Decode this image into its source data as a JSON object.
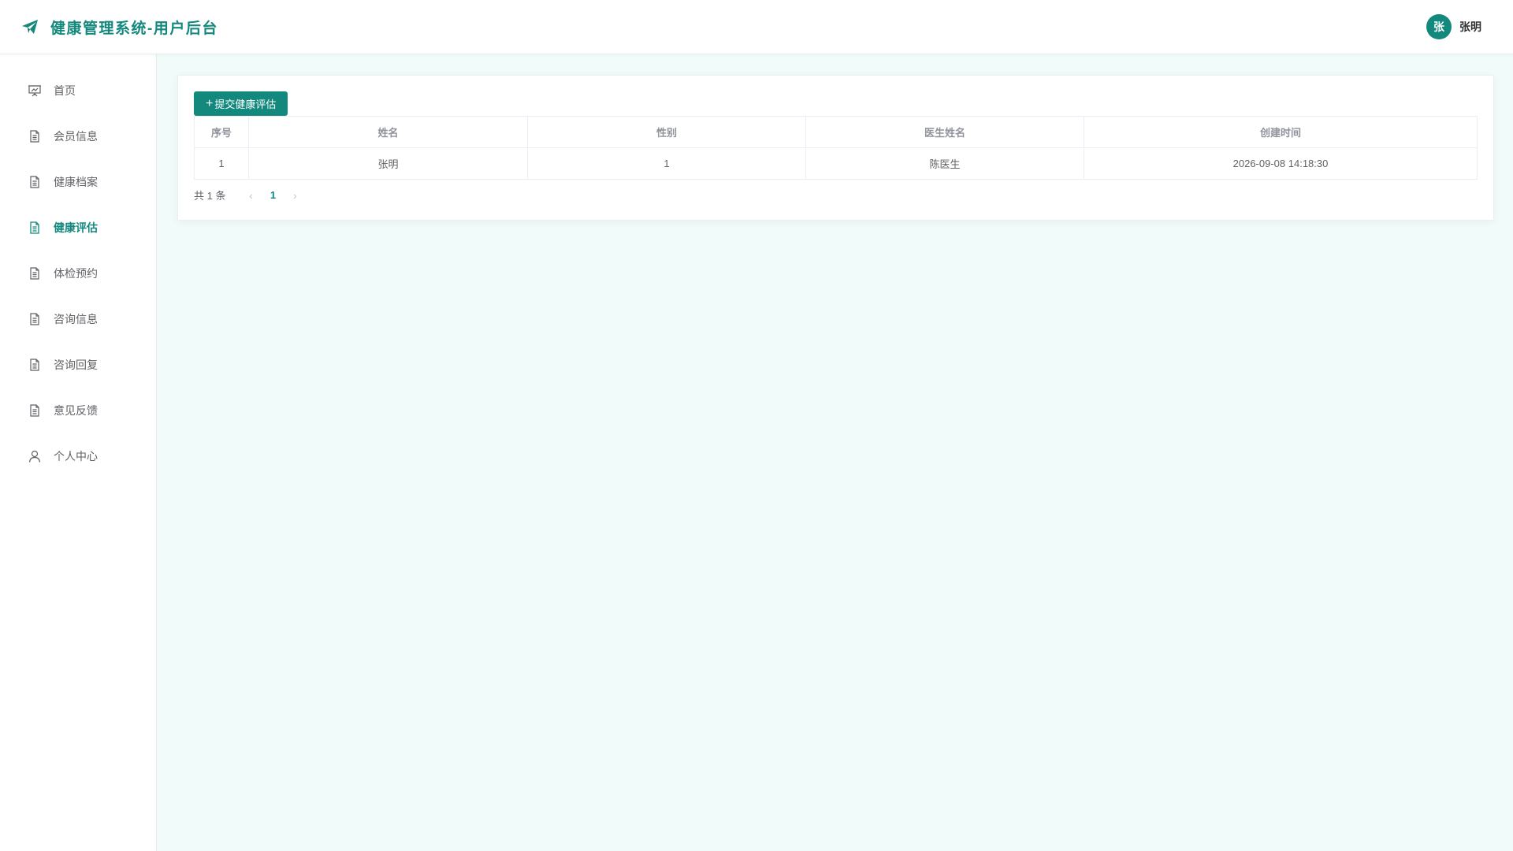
{
  "header": {
    "title": "健康管理系统-用户后台",
    "avatar_text": "张",
    "user_name": "张明"
  },
  "sidebar": {
    "items": [
      {
        "label": "首页",
        "icon": "presentation-icon"
      },
      {
        "label": "会员信息",
        "icon": "document-icon"
      },
      {
        "label": "健康档案",
        "icon": "document-icon"
      },
      {
        "label": "健康评估",
        "icon": "document-icon",
        "active": true
      },
      {
        "label": "体检预约",
        "icon": "document-icon"
      },
      {
        "label": "咨询信息",
        "icon": "document-icon"
      },
      {
        "label": "咨询回复",
        "icon": "document-icon"
      },
      {
        "label": "意见反馈",
        "icon": "document-icon"
      },
      {
        "label": "个人中心",
        "icon": "user-icon"
      }
    ]
  },
  "toolbar": {
    "add_button_plus": "+",
    "add_button_label": "提交健康评估"
  },
  "table": {
    "columns": [
      "序号",
      "姓名",
      "性别",
      "医生姓名",
      "创建时间"
    ],
    "rows": [
      [
        "1",
        "张明",
        "1",
        "陈医生",
        "2026-09-08 14:18:30"
      ]
    ]
  },
  "pagination": {
    "total_text": "共 1 条",
    "prev": "‹",
    "current_page": "1",
    "next": "›"
  },
  "colors": {
    "accent": "#13887d",
    "background": "#f1fbf9"
  }
}
